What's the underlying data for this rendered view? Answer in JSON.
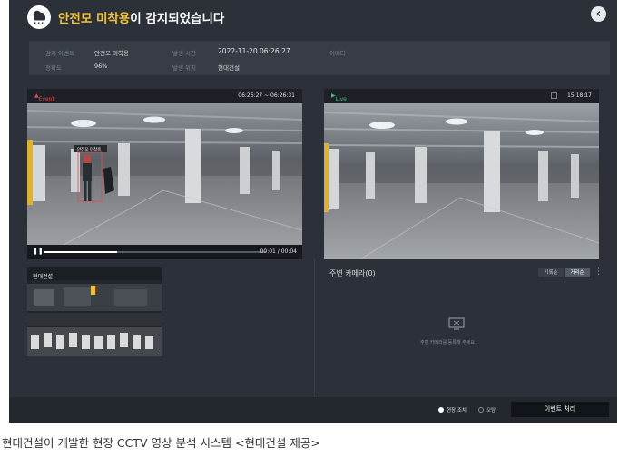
{
  "header": {
    "title_highlight": "안전모 미착용",
    "title_rest": "이 감지되었습니다",
    "close_glyph": "‹"
  },
  "info": {
    "event_label": "감지 이벤트",
    "event_value": "안전모 미착용",
    "accuracy_label": "정확도",
    "accuracy_value": "96%",
    "time_label": "발생 시간",
    "time_value": "2022-11-20 06:26:27",
    "location_label": "발생 위치",
    "location_value": "현대건설",
    "memo_label": "이메타"
  },
  "event_video": {
    "badge": "Event",
    "time_range": "06:26:27 ~ 06:26:31",
    "person_tag": "안전모 미착용",
    "playback": "00:01 / 00:04",
    "progress": 0.33
  },
  "live_video": {
    "badge": "Live",
    "clock": "15:18:17"
  },
  "thumbnail": {
    "label": "현대건설"
  },
  "nearby": {
    "title": "주변 카메라(0)",
    "tab_list": "기록순",
    "tab_distance": "거리순",
    "empty_msg": "주변 카메라를 등록해 주세요."
  },
  "footer": {
    "radio_onsite": "현장 조치",
    "radio_false": "오탐",
    "event_button": "이벤트 처리"
  },
  "caption": "현대건설이 개발한 현장 CCTV 영상 분석 시스템 <현대건설 제공>",
  "colors": {
    "background": "#2c3139",
    "highlight": "#f4c430",
    "event_badge": "#e8484a",
    "live_badge": "#3cc46c"
  }
}
